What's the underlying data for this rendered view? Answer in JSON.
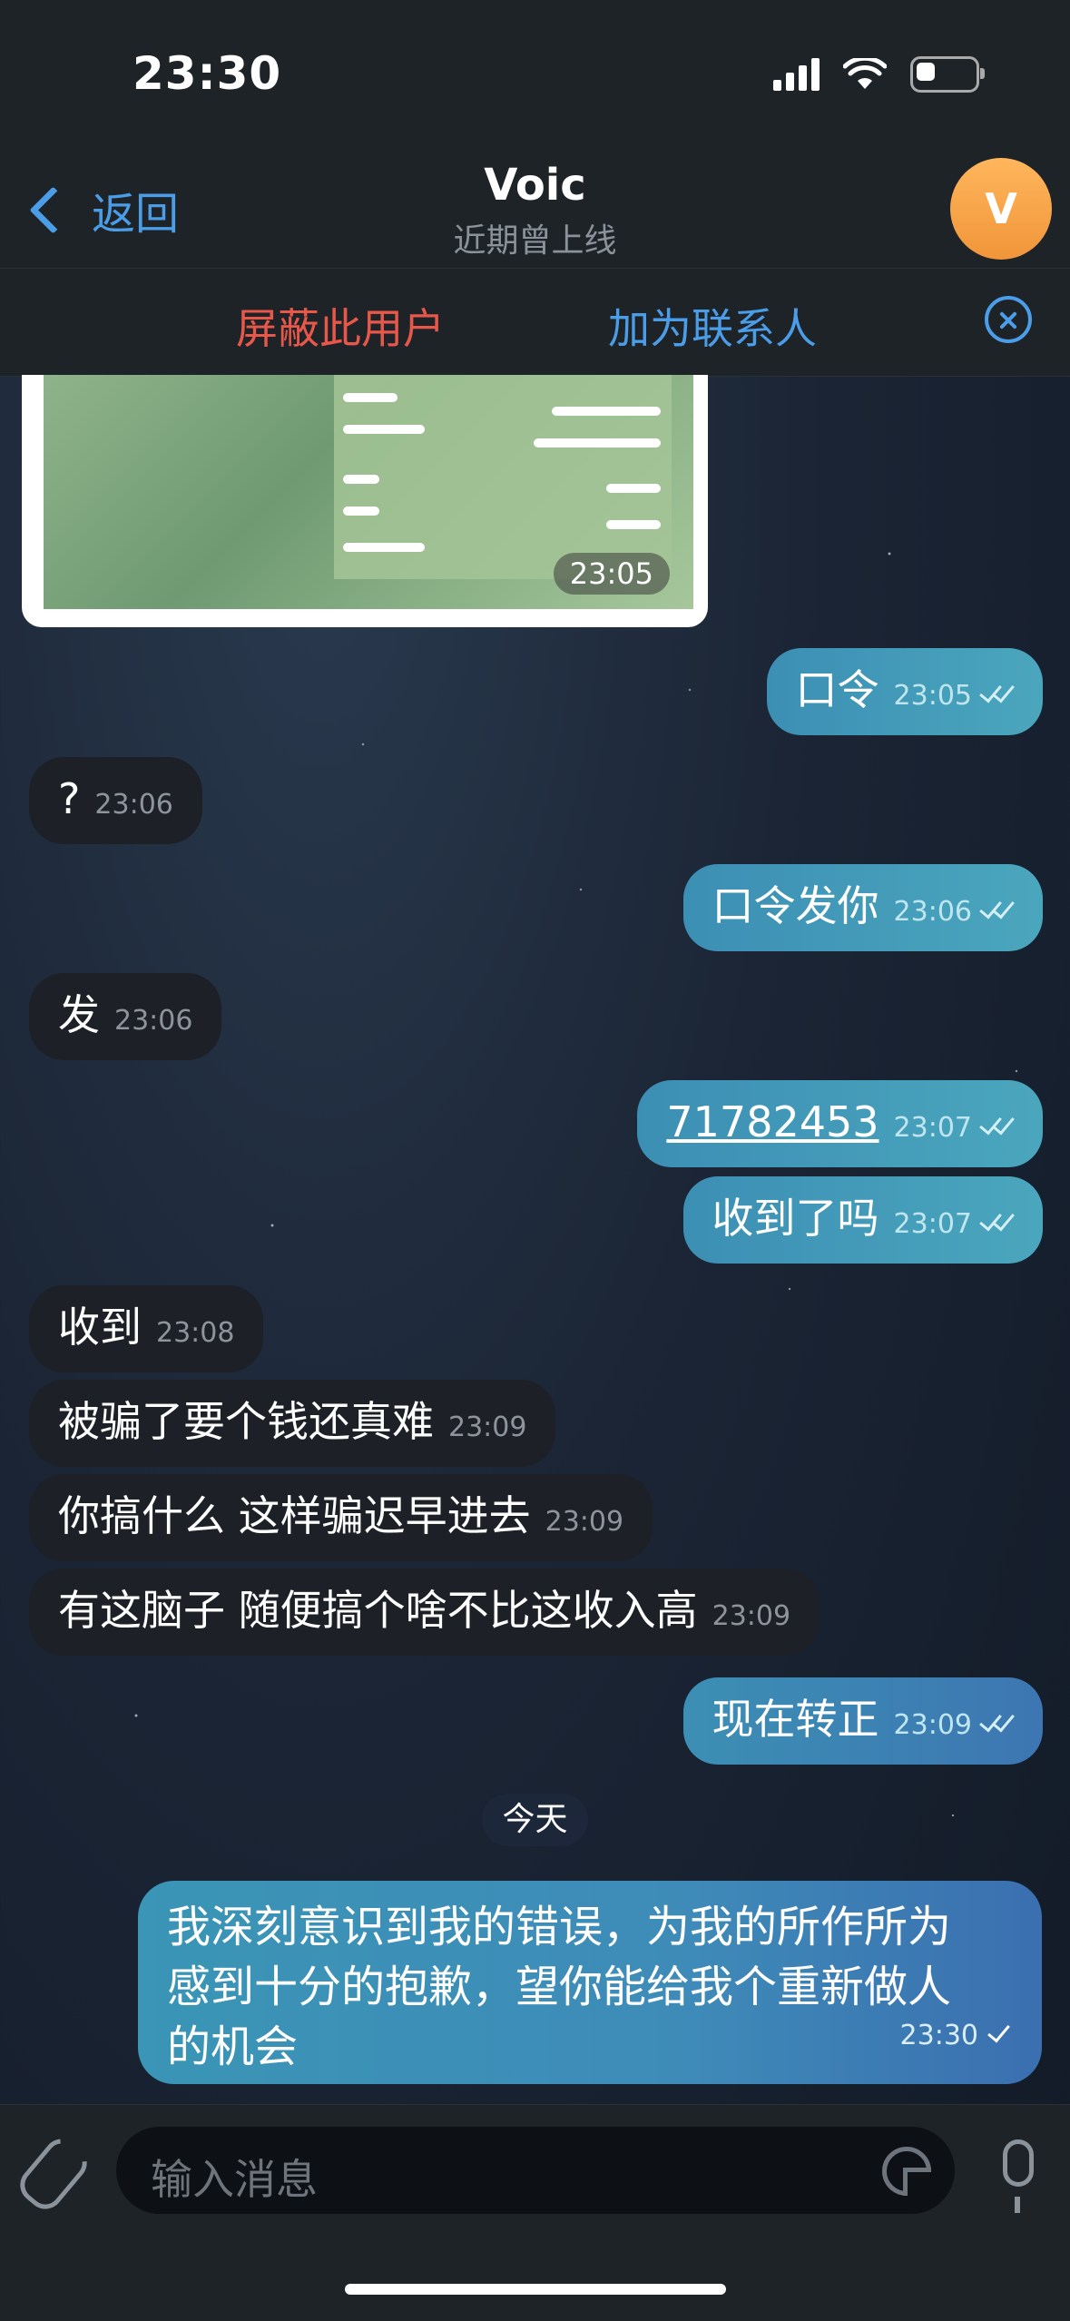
{
  "status_bar": {
    "time": "23:30"
  },
  "header": {
    "back_label": "返回",
    "title": "Voic",
    "subtitle": "近期曾上线",
    "avatar_letter": "V"
  },
  "action_bar": {
    "block_label": "屏蔽此用户",
    "add_contact_label": "加为联系人"
  },
  "image_message": {
    "time": "23:05"
  },
  "messages": [
    {
      "dir": "out",
      "text": "口令",
      "time": "23:05",
      "status": "read"
    },
    {
      "dir": "in",
      "text": "?",
      "time": "23:06"
    },
    {
      "dir": "out",
      "text": "口令发你",
      "time": "23:06",
      "status": "read"
    },
    {
      "dir": "in",
      "text": "发",
      "time": "23:06"
    },
    {
      "dir": "out",
      "text": "71782453",
      "time": "23:07",
      "status": "read"
    },
    {
      "dir": "out",
      "text": "收到了吗",
      "time": "23:07",
      "status": "read"
    },
    {
      "dir": "in",
      "text": "收到",
      "time": "23:08"
    },
    {
      "dir": "in",
      "text": "被骗了要个钱还真难",
      "time": "23:09"
    },
    {
      "dir": "in",
      "text": "你搞什么 这样骗迟早进去",
      "time": "23:09"
    },
    {
      "dir": "in",
      "text": "有这脑子 随便搞个啥不比这收入高",
      "time": "23:09"
    },
    {
      "dir": "out",
      "text": "现在转正",
      "time": "23:09",
      "status": "read"
    }
  ],
  "date_divider": "今天",
  "last_message": {
    "line1": "我深刻意识到我的错误，为我的所作所为",
    "line2": "感到十分的抱歉，望你能给我个重新做人",
    "line3": "的机会",
    "time": "23:30",
    "status": "sent"
  },
  "composer": {
    "placeholder": "输入消息"
  }
}
